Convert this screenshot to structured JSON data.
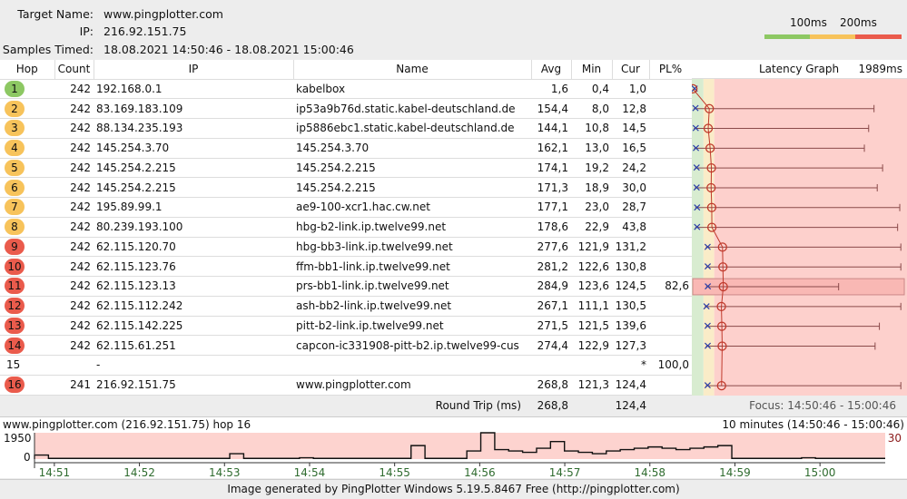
{
  "header": {
    "target_label": "Target Name:",
    "target": "www.pingplotter.com",
    "ip_label": "IP:",
    "ip": "216.92.151.75",
    "samples_label": "Samples Timed:",
    "samples": "18.08.2021 14:50:46 - 18.08.2021 15:00:46"
  },
  "legend": {
    "l1": "100ms",
    "l2": "200ms",
    "colors": {
      "good": "#8dc863",
      "warn": "#f7c35b",
      "bad": "#ea5b4c"
    }
  },
  "columns": {
    "hop": "Hop",
    "count": "Count",
    "ip": "IP",
    "name": "Name",
    "avg": "Avg",
    "min": "Min",
    "cur": "Cur",
    "pl": "PL%",
    "graph": "Latency Graph",
    "graph_max": "1989ms"
  },
  "graph_scale_ms": 1989,
  "rows": [
    {
      "hop": "1",
      "count": "242",
      "ip": "192.168.0.1",
      "name": "kabelbox",
      "avg": "1,6",
      "min": "0,4",
      "cur": "1,0",
      "pl": "",
      "status": "good",
      "max_ms": null
    },
    {
      "hop": "2",
      "count": "242",
      "ip": "83.169.183.109",
      "name": "ip53a9b76d.static.kabel-deutschland.de",
      "avg": "154,4",
      "min": "8,0",
      "cur": "12,8",
      "pl": "",
      "status": "warn",
      "max_ms": 1690
    },
    {
      "hop": "3",
      "count": "242",
      "ip": "88.134.235.193",
      "name": "ip5886ebc1.static.kabel-deutschland.de",
      "avg": "144,1",
      "min": "10,8",
      "cur": "14,5",
      "pl": "",
      "status": "warn",
      "max_ms": 1640
    },
    {
      "hop": "4",
      "count": "242",
      "ip": "145.254.3.70",
      "name": "145.254.3.70",
      "avg": "162,1",
      "min": "13,0",
      "cur": "16,5",
      "pl": "",
      "status": "warn",
      "max_ms": 1600
    },
    {
      "hop": "5",
      "count": "242",
      "ip": "145.254.2.215",
      "name": "145.254.2.215",
      "avg": "174,1",
      "min": "19,2",
      "cur": "24,2",
      "pl": "",
      "status": "warn",
      "max_ms": 1770
    },
    {
      "hop": "6",
      "count": "242",
      "ip": "145.254.2.215",
      "name": "145.254.2.215",
      "avg": "171,3",
      "min": "18,9",
      "cur": "30,0",
      "pl": "",
      "status": "warn",
      "max_ms": 1720
    },
    {
      "hop": "7",
      "count": "242",
      "ip": "195.89.99.1",
      "name": "ae9-100-xcr1.hac.cw.net",
      "avg": "177,1",
      "min": "23,0",
      "cur": "28,7",
      "pl": "",
      "status": "warn",
      "max_ms": 1930
    },
    {
      "hop": "8",
      "count": "242",
      "ip": "80.239.193.100",
      "name": "hbg-b2-link.ip.twelve99.net",
      "avg": "178,6",
      "min": "22,9",
      "cur": "43,8",
      "pl": "",
      "status": "warn",
      "max_ms": 1910
    },
    {
      "hop": "9",
      "count": "242",
      "ip": "62.115.120.70",
      "name": "hbg-bb3-link.ip.twelve99.net",
      "avg": "277,6",
      "min": "121,9",
      "cur": "131,2",
      "pl": "",
      "status": "bad",
      "max_ms": 1940
    },
    {
      "hop": "10",
      "count": "242",
      "ip": "62.115.123.76",
      "name": "ffm-bb1-link.ip.twelve99.net",
      "avg": "281,2",
      "min": "122,6",
      "cur": "130,8",
      "pl": "",
      "status": "bad",
      "max_ms": 1940
    },
    {
      "hop": "11",
      "count": "242",
      "ip": "62.115.123.13",
      "name": "prs-bb1-link.ip.twelve99.net",
      "avg": "284,9",
      "min": "123,6",
      "cur": "124,5",
      "pl": "82,6",
      "status": "bad",
      "max_ms": 1360,
      "selected": true
    },
    {
      "hop": "12",
      "count": "242",
      "ip": "62.115.112.242",
      "name": "ash-bb2-link.ip.twelve99.net",
      "avg": "267,1",
      "min": "111,1",
      "cur": "130,5",
      "pl": "",
      "status": "bad",
      "max_ms": 1940
    },
    {
      "hop": "13",
      "count": "242",
      "ip": "62.115.142.225",
      "name": "pitt-b2-link.ip.twelve99.net",
      "avg": "271,5",
      "min": "121,5",
      "cur": "139,6",
      "pl": "",
      "status": "bad",
      "max_ms": 1740
    },
    {
      "hop": "14",
      "count": "242",
      "ip": "62.115.61.251",
      "name": "capcon-ic331908-pitt-b2.ip.twelve99-cus",
      "avg": "274,4",
      "min": "122,9",
      "cur": "127,3",
      "pl": "",
      "status": "bad",
      "max_ms": 1700
    },
    {
      "hop": "15",
      "count": "",
      "ip": "-",
      "name": "",
      "avg": "",
      "min": "",
      "cur": "*",
      "pl": "100,0",
      "status": "none",
      "max_ms": null
    },
    {
      "hop": "16",
      "count": "241",
      "ip": "216.92.151.75",
      "name": "www.pingplotter.com",
      "avg": "268,8",
      "min": "121,3",
      "cur": "124,4",
      "pl": "",
      "status": "bad",
      "max_ms": 1940
    }
  ],
  "roundtrip": {
    "label": "Round Trip (ms)",
    "avg": "268,8",
    "cur": "124,4",
    "focus": "Focus: 14:50:46 - 15:00:46"
  },
  "mini": {
    "title": "www.pingplotter.com (216.92.151.75) hop 16",
    "range": "10 minutes (14:50:46 - 15:00:46)",
    "ymax": "1950",
    "ymin": "0",
    "right": "30",
    "ticks": [
      "14:51",
      "14:52",
      "14:53",
      "14:54",
      "14:55",
      "14:56",
      "14:57",
      "14:58",
      "14:59",
      "15:00"
    ],
    "samples_ms": [
      300,
      50,
      50,
      50,
      50,
      50,
      50,
      50,
      50,
      50,
      50,
      50,
      50,
      50,
      400,
      50,
      50,
      50,
      50,
      100,
      50,
      50,
      50,
      50,
      50,
      50,
      50,
      1000,
      50,
      50,
      50,
      600,
      1950,
      700,
      600,
      500,
      800,
      1300,
      600,
      500,
      400,
      600,
      700,
      800,
      900,
      800,
      700,
      800,
      900,
      1000,
      50,
      50,
      50,
      50,
      50,
      100,
      50,
      50,
      50,
      50,
      50
    ]
  },
  "footer": "Image generated by PingPlotter Windows 5.19.5.8467 Free (http://pingplotter.com)"
}
